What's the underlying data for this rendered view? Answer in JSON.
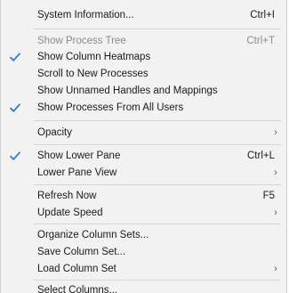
{
  "menu": {
    "items": [
      {
        "label": "System Information...",
        "shortcut": "Ctrl+I"
      },
      {
        "label": "Show Process Tree",
        "shortcut": "Ctrl+T",
        "disabled": true
      },
      {
        "label": "Show Column Heatmaps",
        "checked": true
      },
      {
        "label": "Scroll to New Processes"
      },
      {
        "label": "Show Unnamed Handles and Mappings"
      },
      {
        "label": "Show Processes From All Users",
        "checked": true
      },
      {
        "label": "Opacity",
        "submenu": true
      },
      {
        "label": "Show Lower Pane",
        "shortcut": "Ctrl+L",
        "checked": true
      },
      {
        "label": "Lower Pane View",
        "submenu": true
      },
      {
        "label": "Refresh Now",
        "shortcut": "F5"
      },
      {
        "label": "Update Speed",
        "submenu": true
      },
      {
        "label": "Organize Column Sets..."
      },
      {
        "label": "Save Column Set..."
      },
      {
        "label": "Load Column Set",
        "submenu": true
      },
      {
        "label": "Select Columns..."
      }
    ]
  },
  "icons": {
    "check": "checkmark-icon",
    "submenu": "chevron-right-icon",
    "check_color": "#2b7bd6"
  }
}
